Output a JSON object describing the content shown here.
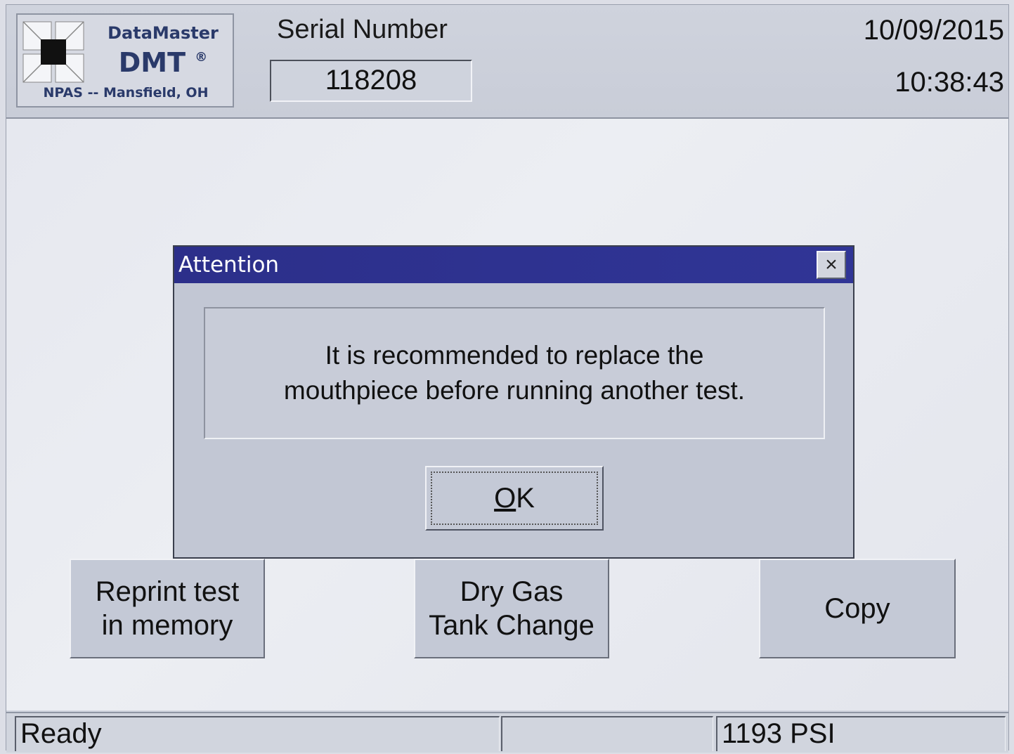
{
  "header": {
    "logo": {
      "title": "DataMaster",
      "product": "DMT",
      "registered_mark": "®",
      "location": "NPAS -- Mansfield, OH"
    },
    "serial_label": "Serial Number",
    "serial_value": "118208",
    "date": "10/09/2015",
    "time": "10:38:43"
  },
  "buttons": {
    "reprint": "Reprint test\nin memory",
    "dry_gas": "Dry Gas\nTank Change",
    "copy": "Copy"
  },
  "dialog": {
    "title": "Attention",
    "close_glyph": "×",
    "message": "It is recommended to replace the\nmouthpiece before running another test.",
    "ok_label": "OK"
  },
  "status_bar": {
    "status": "Ready",
    "middle": "",
    "pressure": "1193 PSI"
  },
  "colors": {
    "titlebar": "#2c2f8a",
    "logo_text": "#2a3a6a"
  }
}
